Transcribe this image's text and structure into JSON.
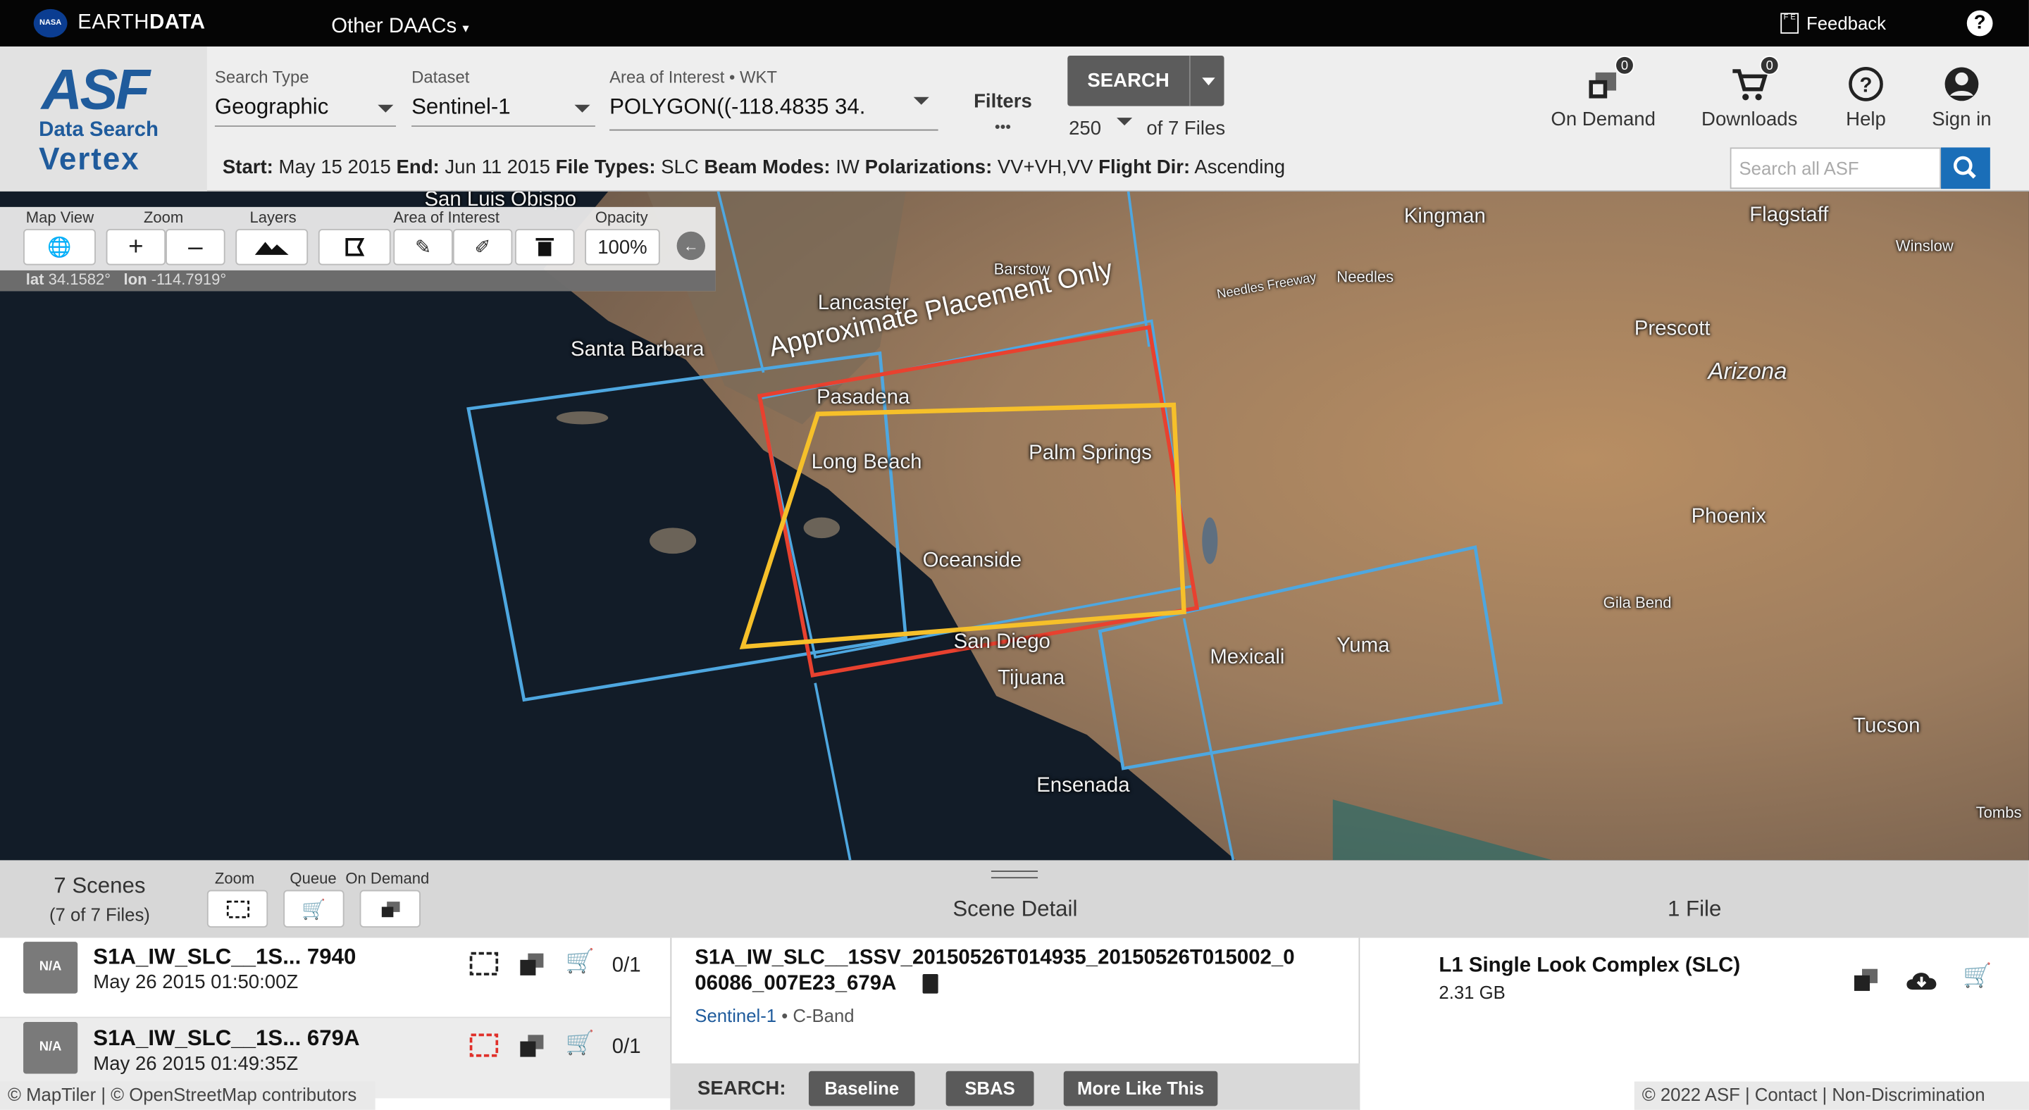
{
  "topbar": {
    "nasa_text": "NASA",
    "brand_plain": "EARTH",
    "brand_bold": "DATA",
    "daacs": "Other DAACs",
    "feedback": "Feedback",
    "feedback_icon": "F E",
    "help": "?"
  },
  "logo": {
    "asf": "ASF",
    "data_search": "Data Search",
    "vertex": "Vertex"
  },
  "search": {
    "search_type_label": "Search Type",
    "search_type_value": "Geographic",
    "dataset_label": "Dataset",
    "dataset_value": "Sentinel-1",
    "aoi_label": "Area of Interest • WKT",
    "aoi_value": "POLYGON((-118.4835 34.",
    "filters_label": "Filters",
    "filters_dots": "•••",
    "search_button": "SEARCH",
    "max_results": "250",
    "of_files": "of 7 Files"
  },
  "header_actions": {
    "on_demand": "On Demand",
    "on_demand_count": "0",
    "downloads": "Downloads",
    "downloads_count": "0",
    "help": "Help",
    "sign_in": "Sign in"
  },
  "summary": {
    "start_label": "Start:",
    "start": "May 15 2015",
    "end_label": "End:",
    "end": "Jun 11 2015",
    "file_types_label": "File Types:",
    "file_types": "SLC",
    "beam_label": "Beam Modes:",
    "beam": "IW",
    "pol_label": "Polarizations:",
    "pol": "VV+VH,VV",
    "dir_label": "Flight Dir:",
    "dir": "Ascending"
  },
  "search_asf_placeholder": "Search all ASF",
  "map_tools": {
    "map_view": "Map View",
    "zoom": "Zoom",
    "layers": "Layers",
    "aoi": "Area of Interest",
    "opacity": "Opacity",
    "zoom_in": "+",
    "zoom_out": "–",
    "opacity_value": "100%",
    "lat_label": "lat",
    "lat": "34.1582°",
    "lon_label": "lon",
    "lon": "-114.7919°"
  },
  "map": {
    "watermark": "Approximate Placement Only",
    "cities": [
      "San Luis Obispo",
      "Kingman",
      "Flagstaff",
      "Winslow",
      "Barstow",
      "Lancaster",
      "Needles",
      "Needles Freeway",
      "Santa Barbara",
      "Prescott",
      "Arizona",
      "Pasadena",
      "Long Beach",
      "Palm Springs",
      "Phoenix",
      "Oceanside",
      "Gila Bend",
      "San Diego",
      "Mexicali",
      "Yuma",
      "Tijuana",
      "Tucson",
      "Ensenada",
      "Tombs"
    ]
  },
  "panel": {
    "scenes_count": "7 Scenes",
    "scenes_files": "(7 of 7 Files)",
    "zoom": "Zoom",
    "queue": "Queue",
    "on_demand": "On Demand",
    "scene_detail": "Scene Detail",
    "files_count": "1 File"
  },
  "scenes": [
    {
      "thumb": "N/A",
      "name": "S1A_IW_SLC__1S... 7940",
      "date": "May 26 2015 01:50:00Z",
      "count": "0/1"
    },
    {
      "thumb": "N/A",
      "name": "S1A_IW_SLC__1S... 679A",
      "date": "May 26 2015 01:49:35Z",
      "count": "0/1"
    }
  ],
  "detail": {
    "name_line1": "S1A_IW_SLC__1SSV_20150526T014935_20150526T015002_0",
    "name_line2": "06086_007E23_679A",
    "dataset": "Sentinel-1",
    "band": "• C-Band",
    "search_label": "SEARCH:",
    "baseline": "Baseline",
    "sbas": "SBAS",
    "more_like_this": "More Like This"
  },
  "file": {
    "title": "L1 Single Look Complex (SLC)",
    "size": "2.31 GB"
  },
  "attribution": {
    "left": "© MapTiler | © OpenStreetMap contributors",
    "right": "© 2022 ASF | Contact | Non-Discrimination"
  }
}
